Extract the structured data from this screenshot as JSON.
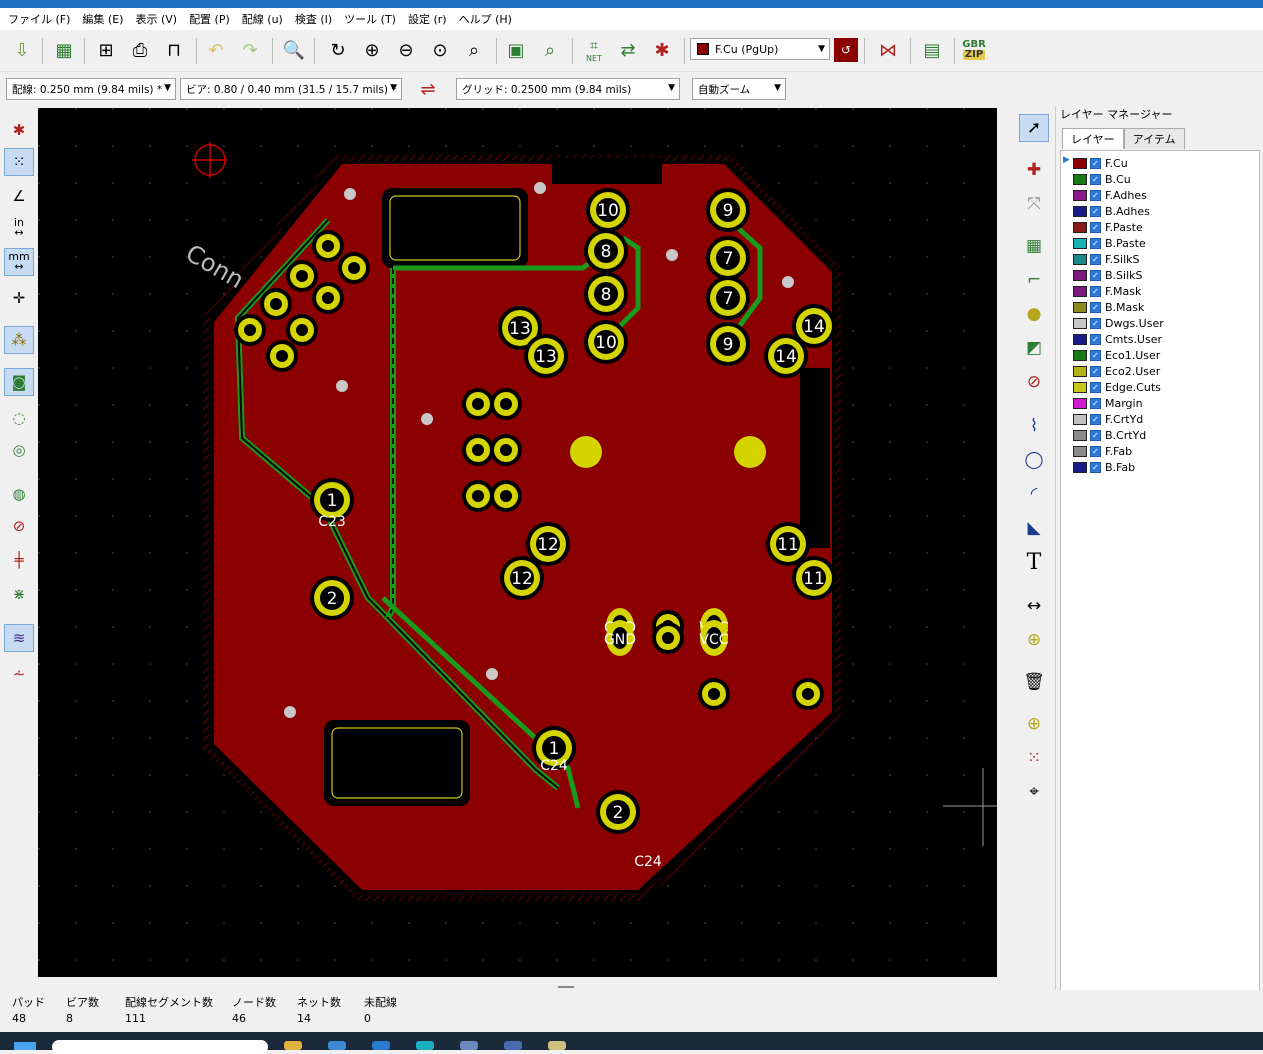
{
  "menu": [
    "ファイル (F)",
    "編集 (E)",
    "表示 (V)",
    "配置 (P)",
    "配線 (u)",
    "検査 (I)",
    "ツール (T)",
    "設定 (r)",
    "ヘルプ (H)"
  ],
  "toolbar": {
    "active_layer": "F.Cu (PgUp)",
    "gbr_label": "GBR",
    "zip_label": "ZIP",
    "net_label": "NET"
  },
  "toolbar2": {
    "track": "配線: 0.250 mm (9.84 mils) *",
    "via": "ビア: 0.80 / 0.40 mm (31.5 / 15.7 mils) *",
    "grid": "グリッド: 0.2500 mm (9.84 mils)",
    "zoom": "自動ズーム"
  },
  "left_tools": {
    "in_label": "in",
    "mm_label": "mm"
  },
  "layer_manager": {
    "title": "レイヤー マネージャー",
    "tabs": [
      "レイヤー",
      "アイテム"
    ],
    "layers": [
      {
        "name": "F.Cu",
        "color": "#8b0000"
      },
      {
        "name": "B.Cu",
        "color": "#1a7a1a"
      },
      {
        "name": "F.Adhes",
        "color": "#8a1a8a"
      },
      {
        "name": "B.Adhes",
        "color": "#1a1a8a"
      },
      {
        "name": "F.Paste",
        "color": "#8b1a1a"
      },
      {
        "name": "B.Paste",
        "color": "#17b3b3"
      },
      {
        "name": "F.SilkS",
        "color": "#1a8a8a"
      },
      {
        "name": "B.SilkS",
        "color": "#7a1a7a"
      },
      {
        "name": "F.Mask",
        "color": "#7a1a7a"
      },
      {
        "name": "B.Mask",
        "color": "#8a8a1a"
      },
      {
        "name": "Dwgs.User",
        "color": "#c8c8c8"
      },
      {
        "name": "Cmts.User",
        "color": "#1a1a8a"
      },
      {
        "name": "Eco1.User",
        "color": "#1a7a1a"
      },
      {
        "name": "Eco2.User",
        "color": "#b3b31a"
      },
      {
        "name": "Edge.Cuts",
        "color": "#c8c81a"
      },
      {
        "name": "Margin",
        "color": "#d01ad0"
      },
      {
        "name": "F.CrtYd",
        "color": "#c0c0c0"
      },
      {
        "name": "B.CrtYd",
        "color": "#8a8a8a"
      },
      {
        "name": "F.Fab",
        "color": "#8a8a8a"
      },
      {
        "name": "B.Fab",
        "color": "#1a1a8a"
      }
    ]
  },
  "status": [
    {
      "label": "パッド",
      "value": "48"
    },
    {
      "label": "ビア数",
      "value": "8"
    },
    {
      "label": "配線セグメント数",
      "value": "111"
    },
    {
      "label": "ノード数",
      "value": "46"
    },
    {
      "label": "ネット数",
      "value": "14"
    },
    {
      "label": "未配線",
      "value": "0"
    }
  ],
  "pcb": {
    "silk_text": "Conn",
    "pads": [
      "10",
      "8",
      "8",
      "10",
      "9",
      "7",
      "7",
      "9",
      "13",
      "13",
      "14",
      "14",
      "1",
      "C23",
      "2",
      "12",
      "12",
      "11",
      "11",
      "1",
      "C24",
      "2",
      "C24",
      "GND",
      "GND",
      "VCC",
      "VCC"
    ]
  }
}
